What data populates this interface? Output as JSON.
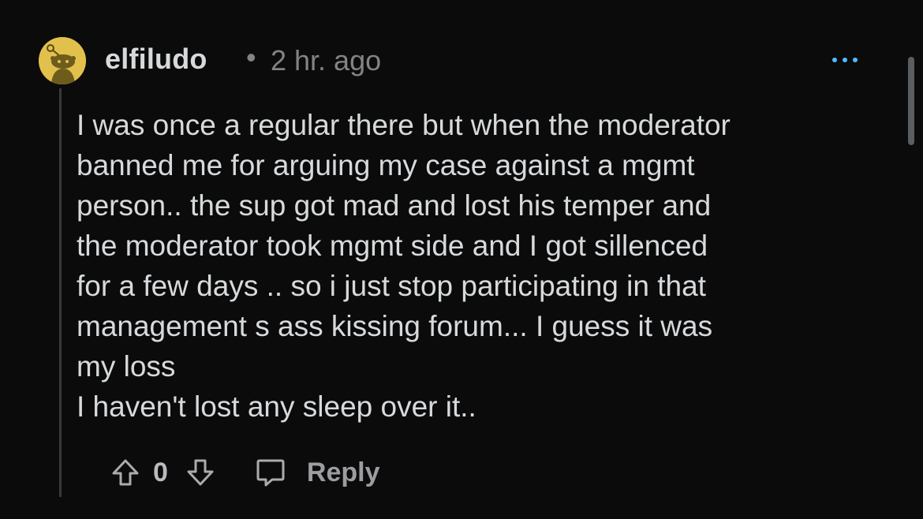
{
  "comment": {
    "author": "elfiludo",
    "separator": "•",
    "timestamp": "2 hr. ago",
    "body_lines": [
      "I was once a regular there but when the moderator",
      "banned me for arguing my case against a mgmt",
      "person.. the sup got mad and lost his temper and",
      "the moderator took mgmt side and I got sillenced",
      "for a few days .. so i just stop participating in that",
      "management s ass kissing forum... I guess it was",
      "my loss",
      "I haven't lost any sleep over it.."
    ],
    "vote_count": "0",
    "reply_label": "Reply"
  },
  "icons": {
    "avatar": "snoo-avatar",
    "more": "more-options-icon",
    "upvote": "upvote-arrow-icon",
    "downvote": "downvote-arrow-icon",
    "reply": "comment-bubble-icon"
  },
  "colors": {
    "background": "#0b0b0b",
    "text": "#d7dadc",
    "muted": "#818384",
    "accent": "#4fbcff",
    "avatar_bg": "#e2c04c"
  }
}
